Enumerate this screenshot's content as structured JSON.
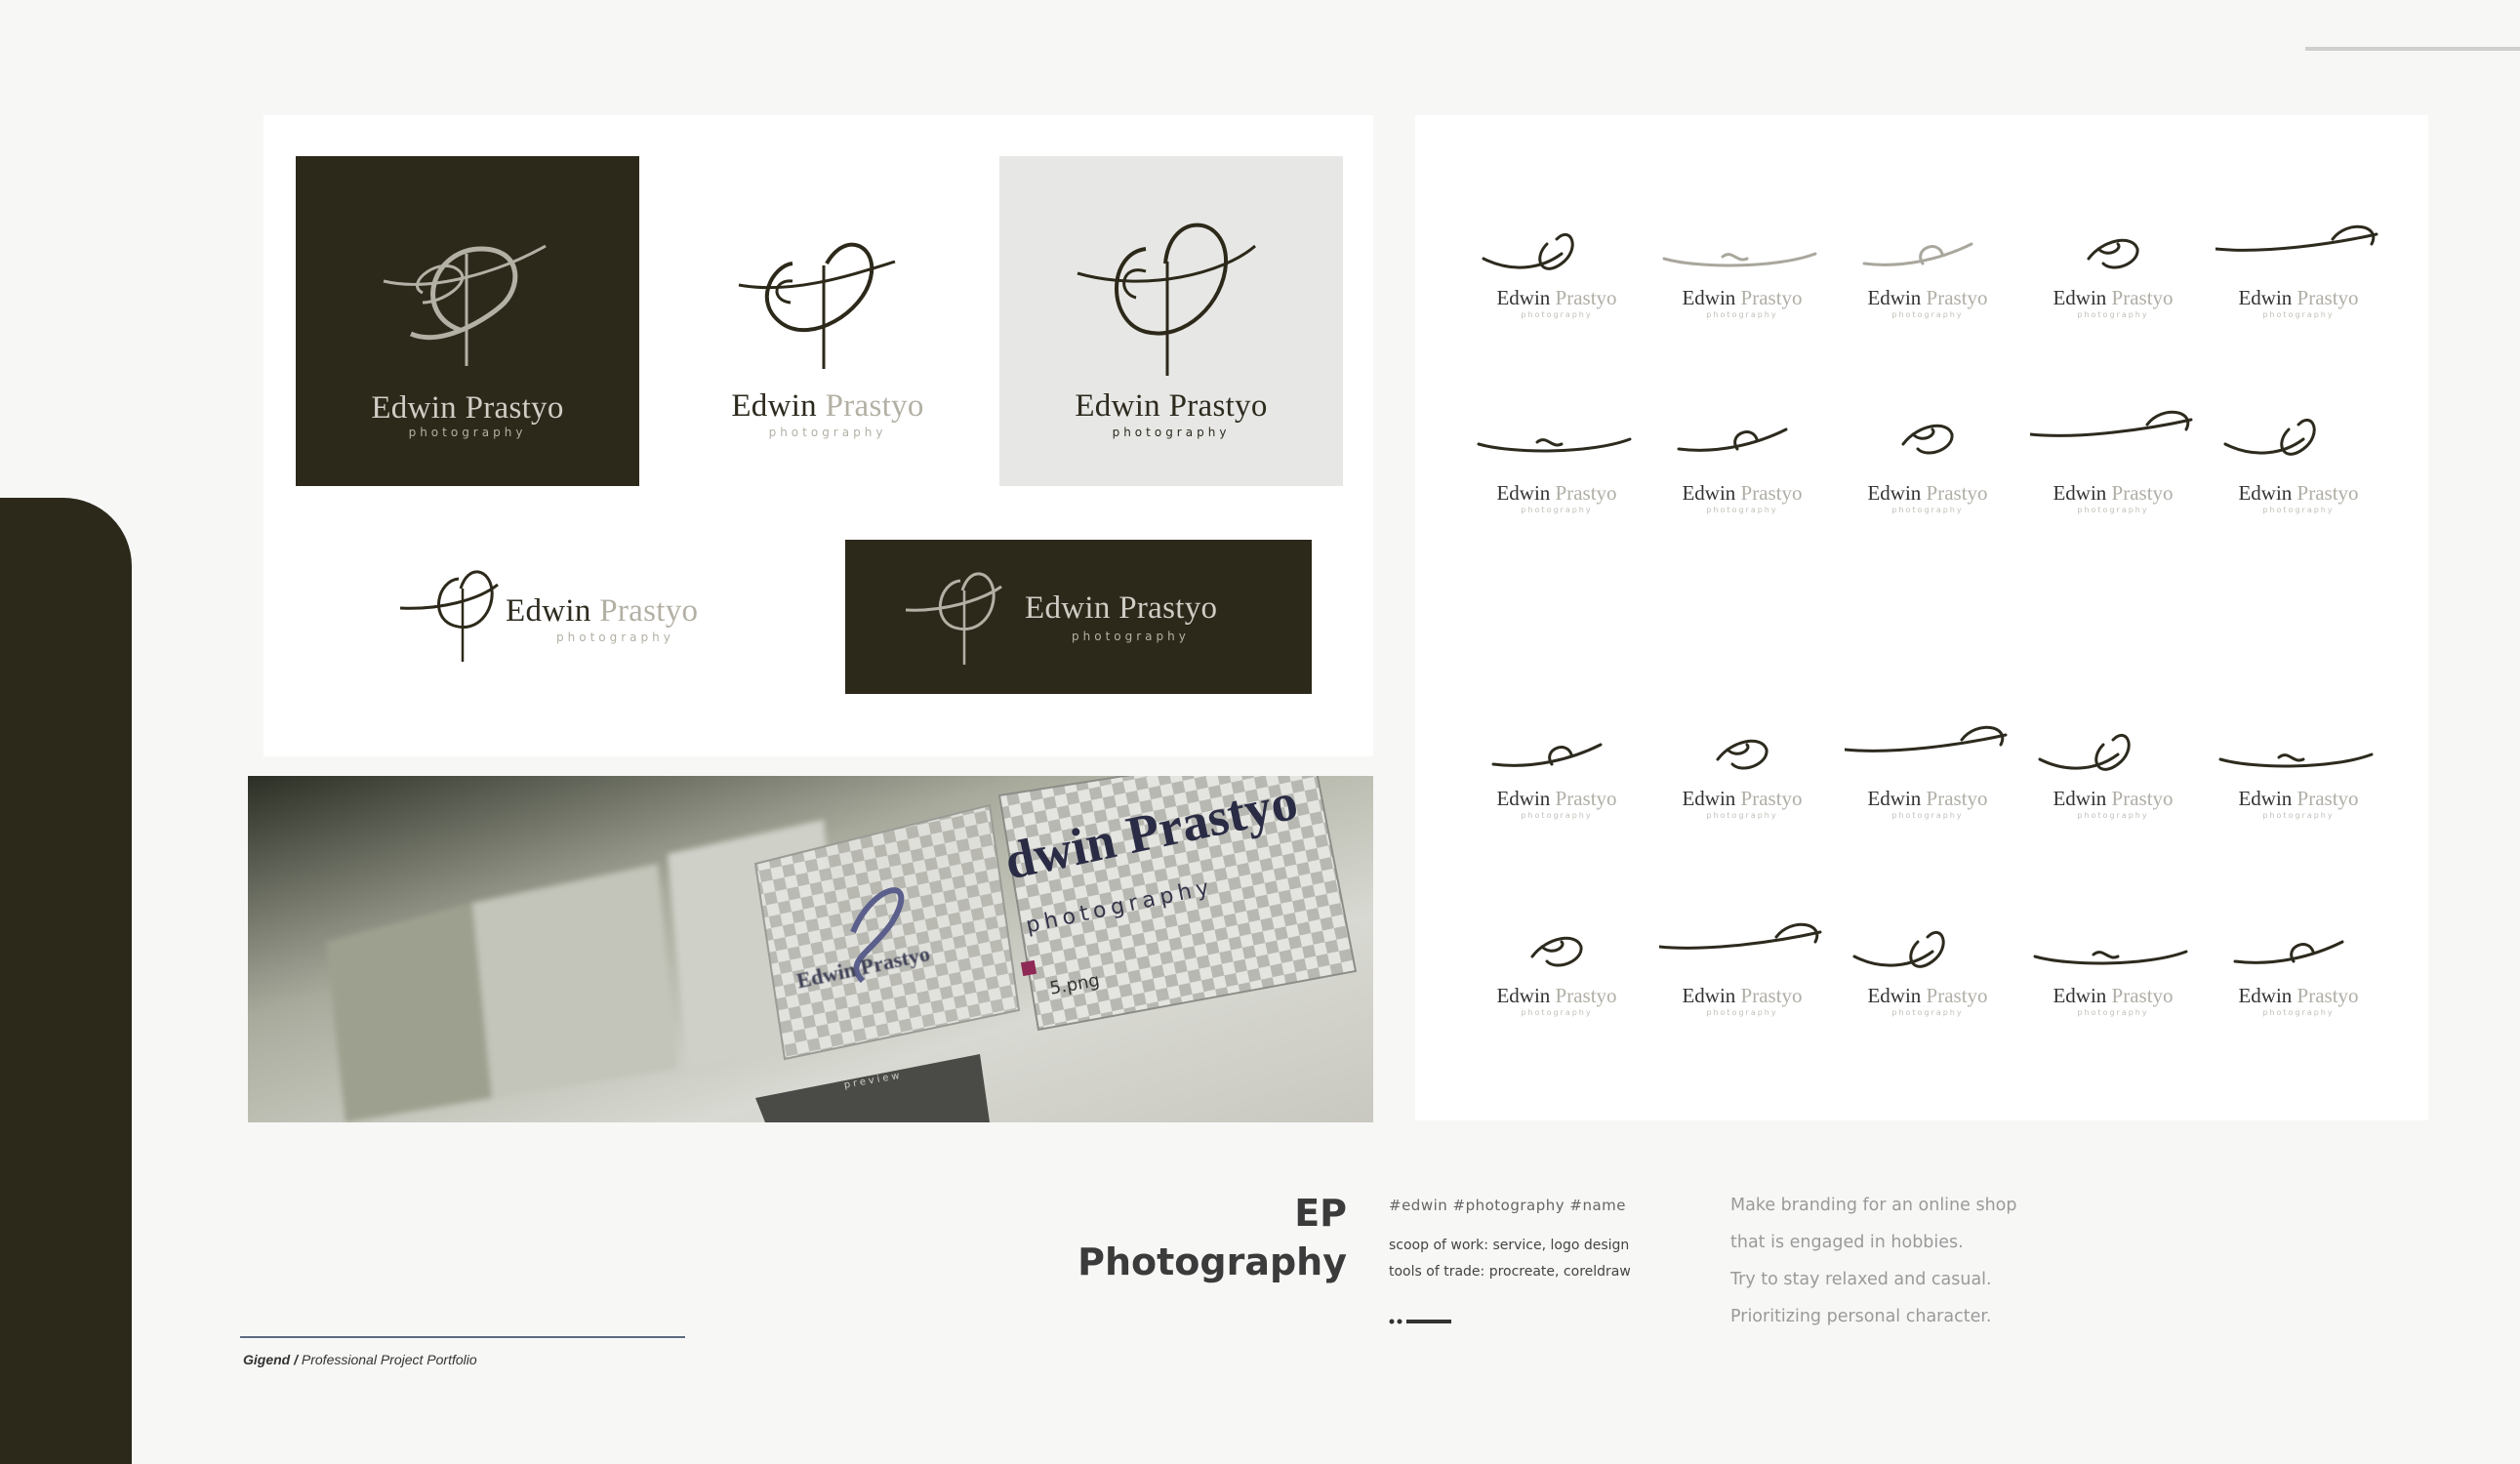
{
  "brand": {
    "name_first": "Edwin",
    "name_last": "Prastyo",
    "tagline": "photography"
  },
  "photo": {
    "headline_fragment": "dwin Prastyo",
    "sub_fragment": "photography",
    "file_label": "5.png",
    "small_label": "Edwin Prastyo",
    "preview_label": "preview"
  },
  "variants": {
    "row1": [
      {
        "first": "Edwin",
        "last": "Prastyo",
        "sub": "photography"
      },
      {
        "first": "Edwin",
        "last": "Prastyo",
        "sub": "photography"
      },
      {
        "first": "Edwin",
        "last": "Prastyo",
        "sub": "photography"
      },
      {
        "first": "Edwin",
        "last": "Prastyo",
        "sub": "photography"
      },
      {
        "first": "Edwin",
        "last": "Prastyo",
        "sub": "photography"
      }
    ]
  },
  "project": {
    "title_line1": "EP",
    "title_line2": "Photography",
    "tags": "#edwin #photography #name",
    "scope": "scoop of work: service, logo design",
    "tools": "tools of trade: procreate, coreldraw",
    "description": [
      "Make branding for an online shop",
      "that is engaged in hobbies.",
      "Try to stay relaxed and casual.",
      "Prioritizing personal character."
    ]
  },
  "footer": {
    "author": "Gigend /",
    "label": "Professional Project Portfolio"
  },
  "colors": {
    "dark_olive": "#2d291a",
    "light_grey_tile": "#e7e7e5",
    "muted_tan": "#b0aea6",
    "footer_rule": "#5d6a80"
  }
}
